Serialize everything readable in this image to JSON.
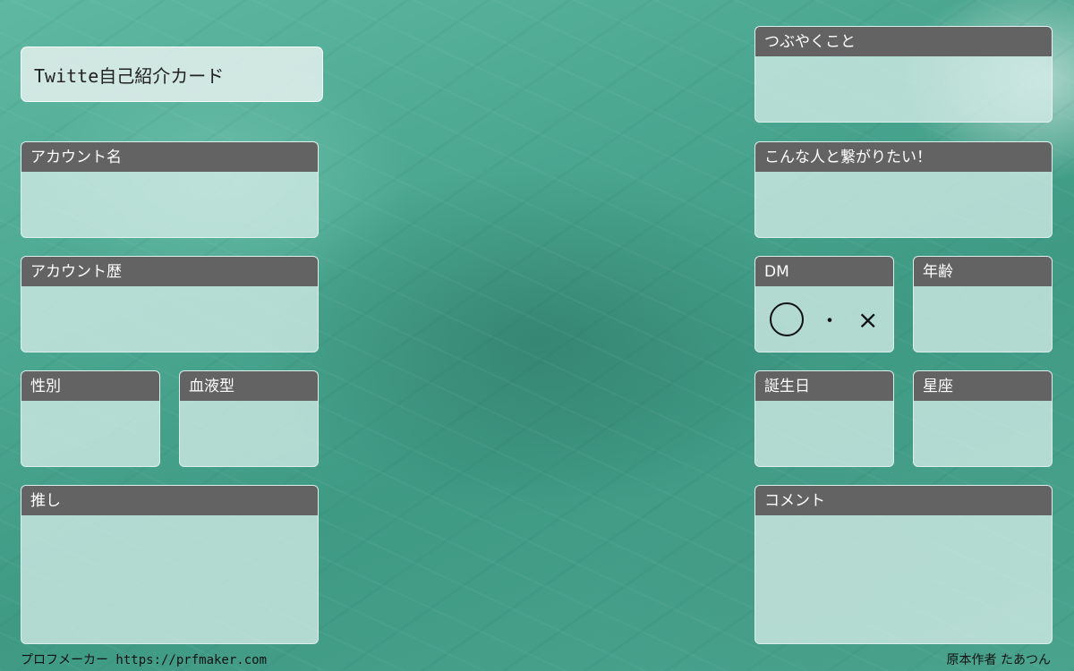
{
  "title": "Twitte自己紹介カード",
  "cards": {
    "account_name": "アカウント名",
    "account_history": "アカウント歴",
    "gender": "性別",
    "blood_type": "血液型",
    "oshi": "推し",
    "tweets": "つぶやくこと",
    "connect_with": "こんな人と繋がりたい！",
    "dm": "DM",
    "age": "年齢",
    "birthday": "誕生日",
    "zodiac": "星座",
    "comment": "コメント"
  },
  "dm_options": {
    "ok": "○",
    "separator": "・",
    "ng": "×"
  },
  "footer": {
    "maker": "プロフメーカー https://prfmaker.com",
    "author": "原本作者 たあつん"
  },
  "colors": {
    "header_bg": "#636363",
    "background": "#4aa68f"
  }
}
